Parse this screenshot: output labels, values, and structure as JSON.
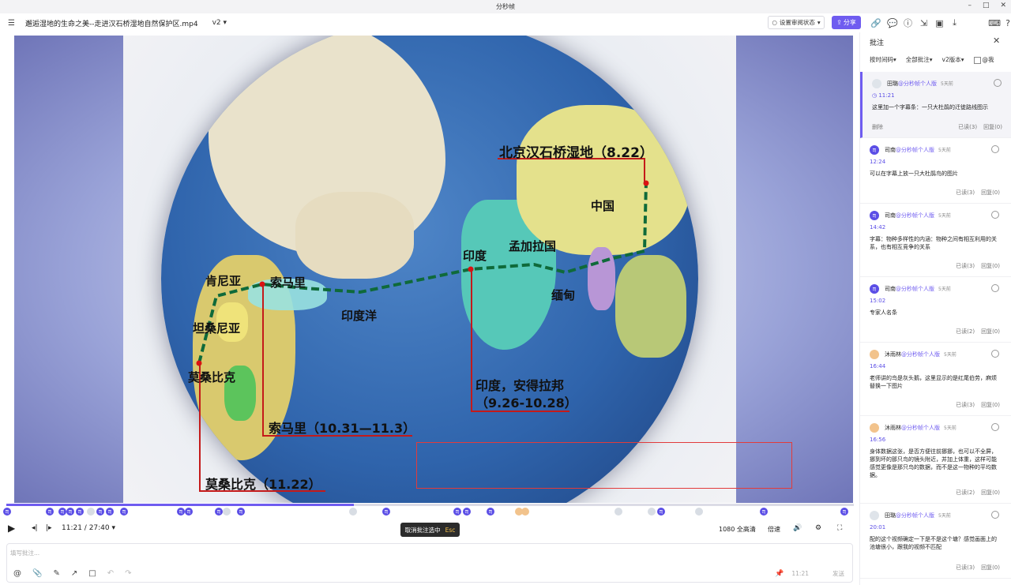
{
  "window": {
    "title": "分秒帧"
  },
  "toolbar": {
    "file_name": "邂逅湿地的生命之美--走进汉石桥湿地自然保护区.mp4",
    "version": "v2",
    "review_status": "设置审阅状态",
    "share": "分享"
  },
  "video": {
    "labels": {
      "beijing": "北京汉石桥湿地（8.22）",
      "china": "中国",
      "india": "印度",
      "bangladesh": "孟加拉国",
      "myanmar": "缅甸",
      "kenya": "肯尼亚",
      "somalia": "索马里",
      "indian_ocean": "印度洋",
      "tanzania": "坦桑尼亚",
      "mozambique": "莫桑比克",
      "india_andhra_1": "印度，安得拉邦",
      "india_andhra_2": "（9.26-10.28）",
      "somalia_date": "索马里（10.31—11.3）",
      "mozambique_date": "莫桑比克（11.22）"
    }
  },
  "player": {
    "progress_fraction": 0.41,
    "time": "11:21 / 27:40",
    "quality": "1080 全高清",
    "speed": "倍速",
    "tooltip_text": "取消批注选中",
    "tooltip_key": "Esc"
  },
  "composer": {
    "placeholder": "填写批注...",
    "time": "11:21",
    "send": "发送"
  },
  "panel": {
    "title": "批注",
    "filters": {
      "sort": "按时间码",
      "all": "全部批注",
      "version": "v2版本",
      "at_me": "@我"
    },
    "comments": [
      {
        "user": "田璐",
        "workspace": "@分秒帧个人版",
        "ago": "5天前",
        "time": "11:21",
        "text": "这里加一个字幕条：一只大杜鹃的迁徙路线图示",
        "delete": "删除",
        "read": "已读(3)",
        "reply": "回复(0)",
        "avatar": "cloud"
      },
      {
        "user": "司南",
        "workspace": "@分秒帧个人版",
        "ago": "5天前",
        "time": "12:24",
        "text": "可以在字幕上放一只大杜鹃鸟的图片",
        "read": "已读(3)",
        "reply": "回复(0)",
        "avatar": "司"
      },
      {
        "user": "司南",
        "workspace": "@分秒帧个人版",
        "ago": "5天前",
        "time": "14:42",
        "text": "字幕：物种多样性的内涵：物种之间有相互利用的关系，也有相互竞争的关系",
        "read": "已读(3)",
        "reply": "回复(0)",
        "avatar": "司"
      },
      {
        "user": "司南",
        "workspace": "@分秒帧个人版",
        "ago": "5天前",
        "time": "15:02",
        "text": "专家人名条",
        "read": "已读(2)",
        "reply": "回复(0)",
        "avatar": "司"
      },
      {
        "user": "沐雨林",
        "workspace": "@分秒帧个人版",
        "ago": "5天前",
        "time": "16:44",
        "text": "老师讲的鸟是灰头鹅，这里显示的是红尾伯劳，麻烦替换一下图片",
        "read": "已读(3)",
        "reply": "回复(0)",
        "avatar": "person"
      },
      {
        "user": "沐雨林",
        "workspace": "@分秒帧个人版",
        "ago": "5天前",
        "time": "16:56",
        "text": "身体数据这张，是否方便往前挪挪，也可以不全屏，挪到坏的那只鸟的镜头附近，并加上体重，这样可能感觉更像是那只鸟的数据，而不是这一物种的平均数据。",
        "read": "已读(2)",
        "reply": "回复(0)",
        "avatar": "person"
      },
      {
        "user": "田璐",
        "workspace": "@分秒帧个人版",
        "ago": "5天前",
        "time": "20:01",
        "text": "配的这个视频确定一下是不是这个塘？感觉画面上的池塘很小，跟我的视频不匹配",
        "read": "已读(3)",
        "reply": "回复(0)",
        "avatar": "cloud"
      }
    ]
  },
  "icons": {
    "menu": "menu-icon",
    "link": "link-icon",
    "comment": "comment-icon",
    "info": "info-icon",
    "export": "export-icon",
    "image": "image-icon",
    "download": "download-icon",
    "keyboard": "keyboard-icon",
    "help": "help-icon"
  }
}
